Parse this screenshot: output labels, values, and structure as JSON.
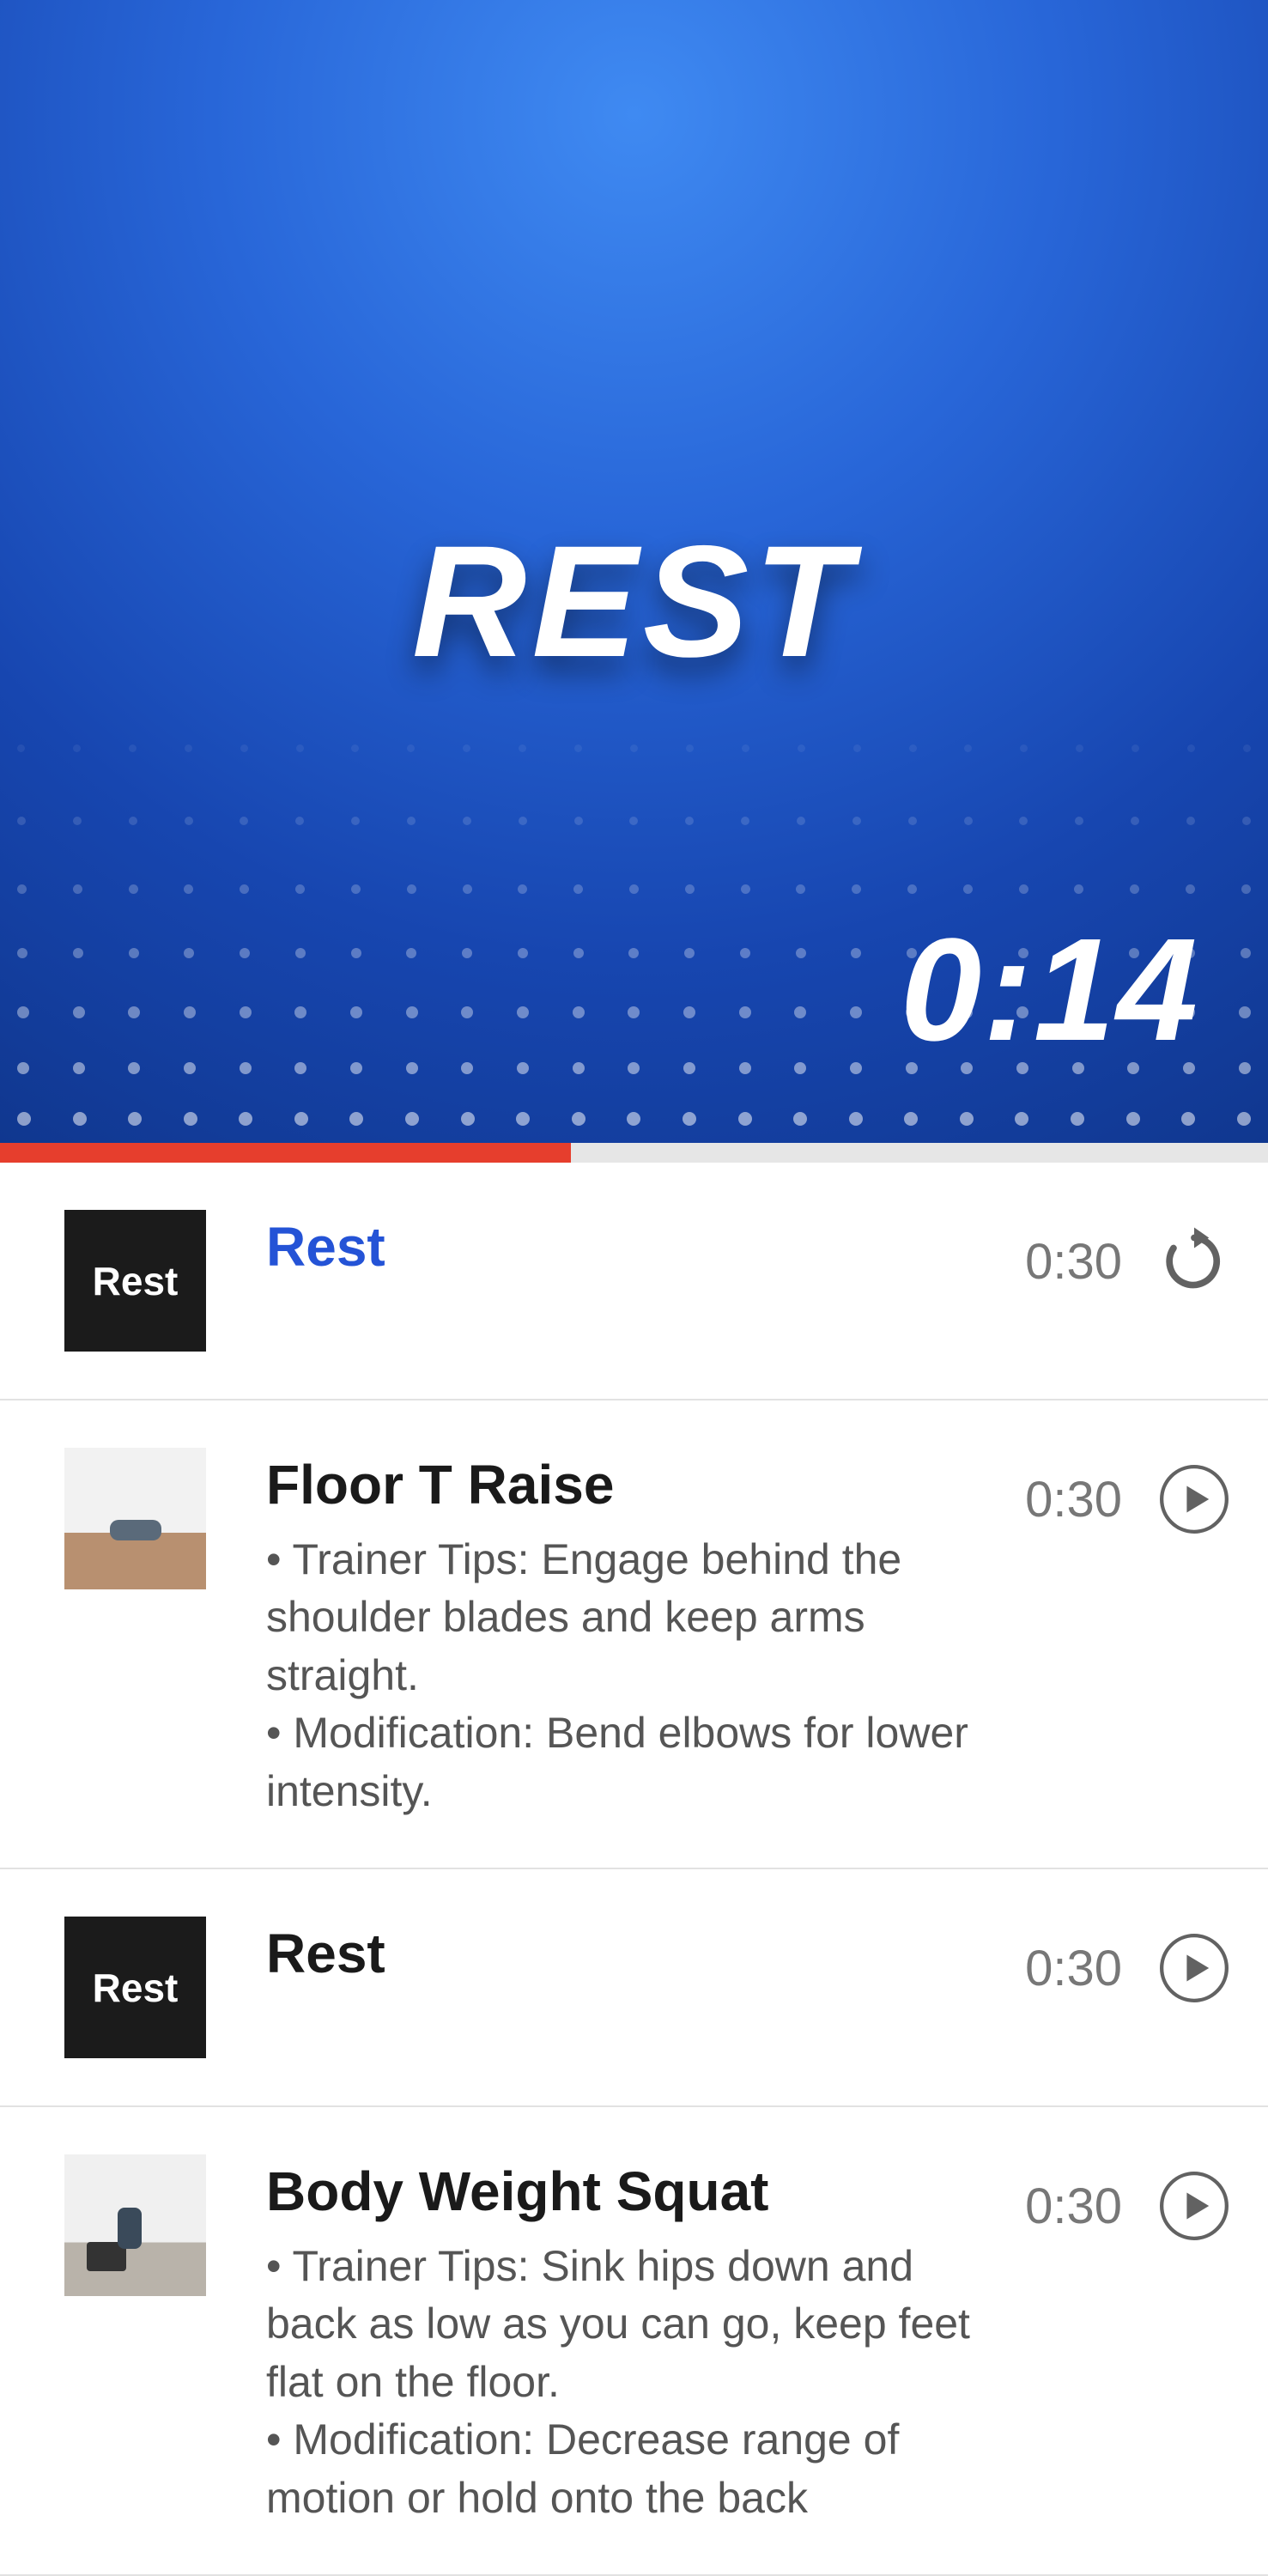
{
  "hero": {
    "title": "REST",
    "timer": "0:14"
  },
  "progress": {
    "percent": 45
  },
  "thumb_labels": {
    "rest": "Rest"
  },
  "items": [
    {
      "title": "Rest",
      "desc": "",
      "duration": "0:30",
      "active": true,
      "thumb": "rest",
      "action": "replay"
    },
    {
      "title": "Floor T Raise",
      "desc": "• Trainer Tips: Engage behind the shoulder blades and keep arms straight.\n• Modification: Bend elbows for lower intensity.",
      "duration": "0:30",
      "active": false,
      "thumb": "photo",
      "action": "play"
    },
    {
      "title": "Rest",
      "desc": "",
      "duration": "0:30",
      "active": false,
      "thumb": "rest",
      "action": "play"
    },
    {
      "title": "Body Weight Squat",
      "desc": "• Trainer Tips: Sink hips down and back as low as you can go, keep feet flat on the floor.\n• Modification: Decrease range of motion or hold onto the back",
      "duration": "0:30",
      "active": false,
      "thumb": "photo2",
      "action": "play"
    }
  ]
}
